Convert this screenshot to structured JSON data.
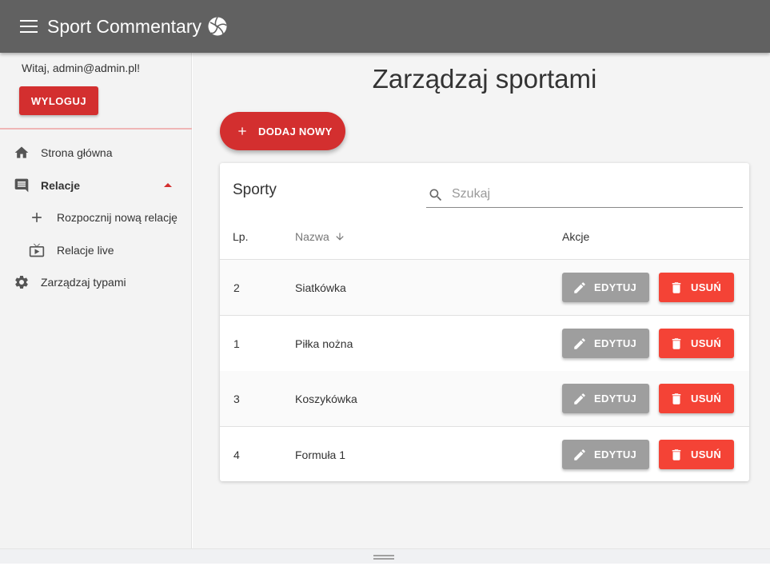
{
  "app": {
    "title": "Sport Commentary"
  },
  "colors": {
    "appbar": "#616161",
    "primary": "#d32f2f",
    "delete": "#f44336",
    "edit": "#9e9e9e"
  },
  "sidebar": {
    "greeting": "Witaj, admin@admin.pl!",
    "logout_label": "WYLOGUJ",
    "items": [
      {
        "label": "Strona główna",
        "icon": "home-icon"
      },
      {
        "label": "Relacje",
        "icon": "comment-icon"
      },
      {
        "label": "Rozpocznij nową relację",
        "icon": "plus-icon"
      },
      {
        "label": "Relacje live",
        "icon": "live-tv-icon"
      },
      {
        "label": "Zarządzaj typami",
        "icon": "gear-icon"
      }
    ]
  },
  "main": {
    "title": "Zarządzaj sportami",
    "add_label": "DODAJ NOWY",
    "card_title": "Sporty",
    "search_placeholder": "Szukaj",
    "columns": {
      "lp": "Lp.",
      "name": "Nazwa",
      "actions": "Akcje"
    },
    "rows": [
      {
        "lp": "2",
        "name": "Siatkówka"
      },
      {
        "lp": "1",
        "name": "Piłka nożna"
      },
      {
        "lp": "3",
        "name": "Koszykówka"
      },
      {
        "lp": "4",
        "name": "Formuła 1"
      }
    ],
    "edit_label": "EDYTUJ",
    "delete_label": "USUŃ"
  }
}
